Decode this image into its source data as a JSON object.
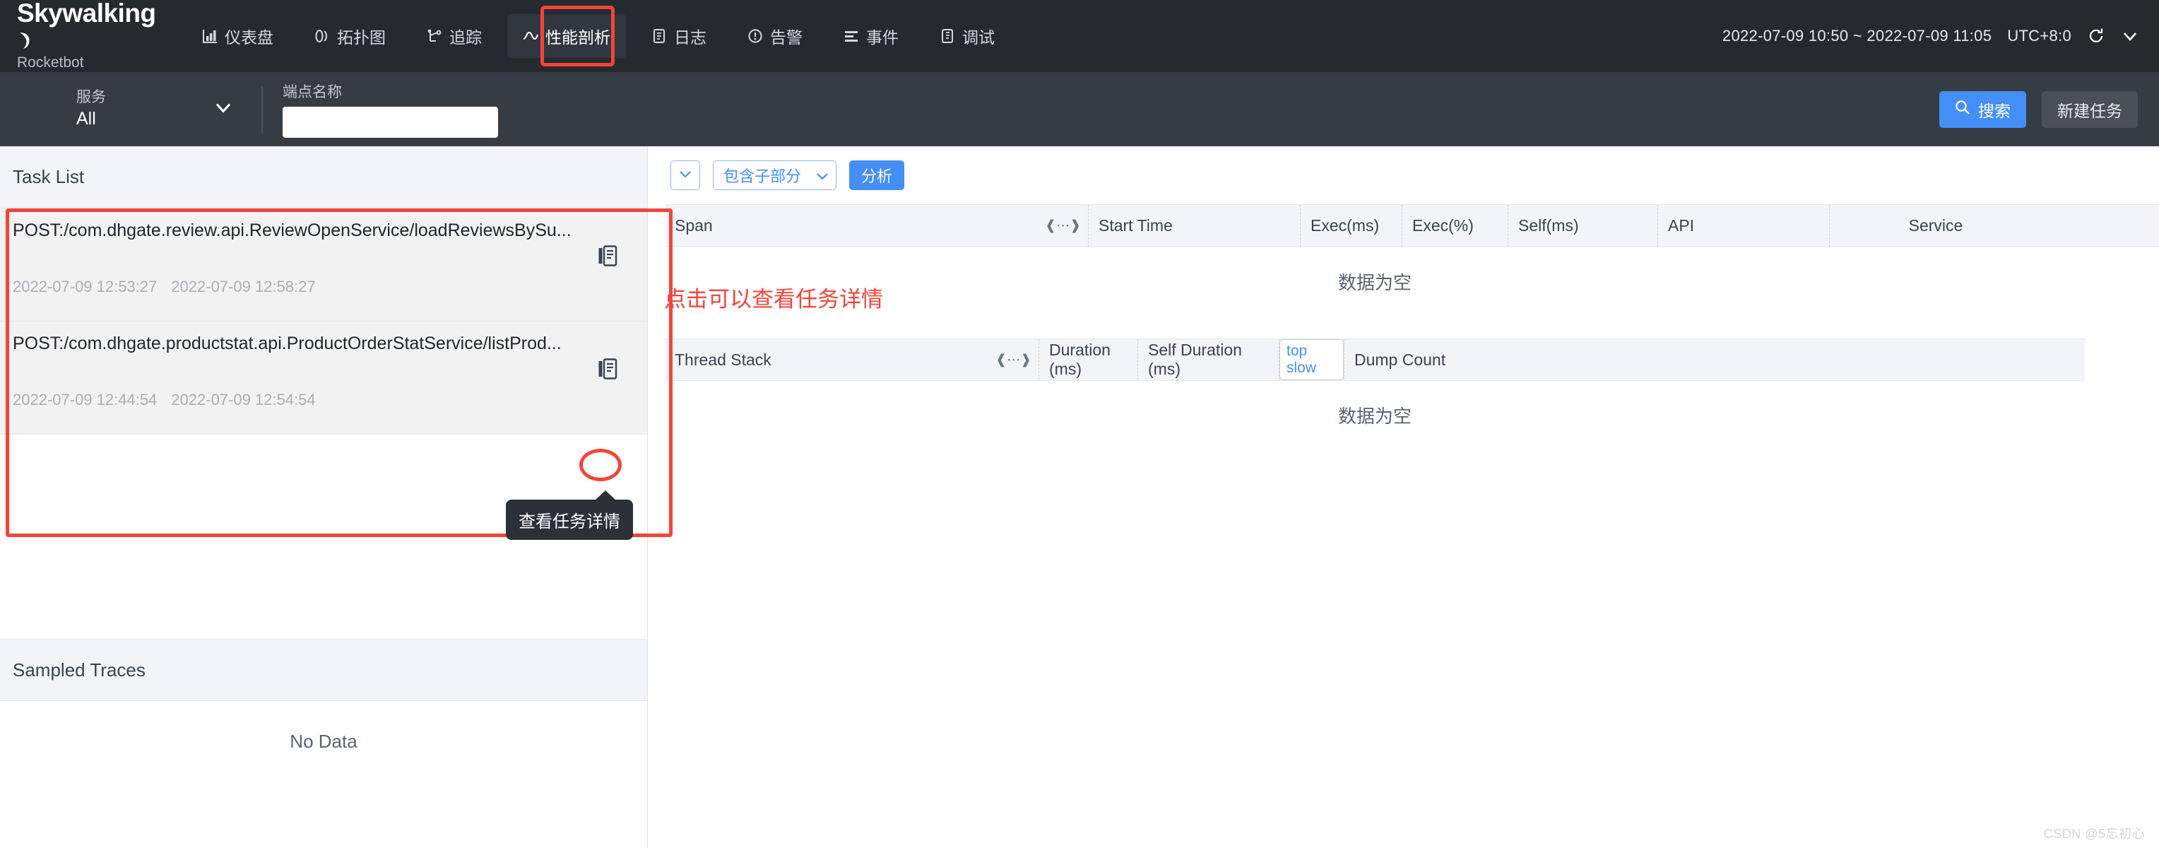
{
  "header": {
    "logo_main": "Skywalking",
    "logo_sub": "Rocketbot",
    "nav": [
      {
        "label": "仪表盘",
        "icon": "dashboard-icon",
        "active": false
      },
      {
        "label": "拓扑图",
        "icon": "topology-icon",
        "active": false
      },
      {
        "label": "追踪",
        "icon": "trace-icon",
        "active": false
      },
      {
        "label": "性能剖析",
        "icon": "profile-icon",
        "active": true
      },
      {
        "label": "日志",
        "icon": "log-icon",
        "active": false
      },
      {
        "label": "告警",
        "icon": "alarm-icon",
        "active": false
      },
      {
        "label": "事件",
        "icon": "events-icon",
        "active": false
      },
      {
        "label": "调试",
        "icon": "debug-icon",
        "active": false
      }
    ],
    "time_range": "2022-07-09 10:50 ~ 2022-07-09 11:05",
    "timezone": "UTC+8:0",
    "refresh_icon": "refresh-icon",
    "chevron_icon": "chevron-down-icon"
  },
  "toolbar": {
    "service_label": "服务",
    "service_value": "All",
    "service_caret_icon": "chevron-down-icon",
    "endpoint_label": "端点名称",
    "endpoint_value": "",
    "endpoint_placeholder": "",
    "search_label": "搜索",
    "search_icon": "search-icon",
    "new_task_label": "新建任务"
  },
  "left_panel": {
    "task_list_title": "Task List",
    "tasks": [
      {
        "name": "POST:/com.dhgate.review.api.ReviewOpenService/loadReviewsBySu...",
        "start_time": "2022-07-09 12:53:27",
        "end_time": "2022-07-09 12:58:27",
        "detail_icon": "task-detail-icon"
      },
      {
        "name": "POST:/com.dhgate.productstat.api.ProductOrderStatService/listProd...",
        "start_time": "2022-07-09 12:44:54",
        "end_time": "2022-07-09 12:54:54",
        "detail_icon": "task-detail-icon"
      }
    ],
    "tooltip": "查看任务详情",
    "annotation": "点击可以查看任务详情",
    "sampled_traces_title": "Sampled Traces",
    "sampled_traces_empty": "No Data"
  },
  "right_panel": {
    "mini_select_icon": "chevron-down-icon",
    "scope_select_value": "包含子部分",
    "scope_select_icon": "chevron-down-icon",
    "analyze_label": "分析",
    "span_table": {
      "columns": [
        "Span",
        "Start Time",
        "Exec(ms)",
        "Exec(%)",
        "Self(ms)",
        "API",
        "Service"
      ],
      "resize_icon": "resize-handle-icon",
      "empty_text": "数据为空",
      "rows": []
    },
    "thread_stack_table": {
      "columns": [
        "Thread Stack",
        "Duration (ms)",
        "Self Duration (ms)",
        "top slow",
        "Dump Count"
      ],
      "resize_icon": "resize-handle-icon",
      "empty_text": "数据为空",
      "rows": []
    }
  },
  "watermark": "CSDN @5忘初心",
  "colors": {
    "header_bg": "#252a2f",
    "toolbar_bg": "#363c44",
    "accent_blue": "#448ef8",
    "annotation_red": "#f4443a",
    "table_head_bg": "#f2f4f8"
  }
}
